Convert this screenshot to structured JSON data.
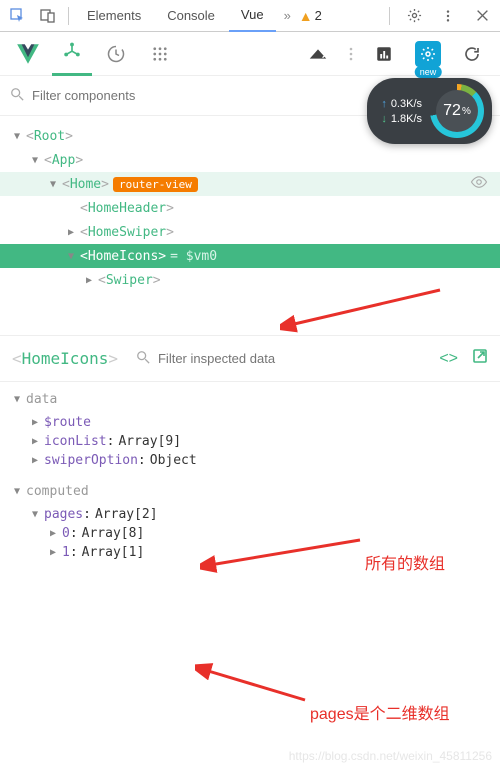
{
  "topTabs": {
    "elements": "Elements",
    "console": "Console",
    "vue": "Vue",
    "moreIndicator": "»",
    "warnCount": "2"
  },
  "toolbar": {
    "newBadge": "new"
  },
  "filter": {
    "placeholder": "Filter components"
  },
  "perf": {
    "up": "0.3K/s",
    "down": "1.8K/s",
    "percent": "72",
    "percentSuffix": "%"
  },
  "tree": [
    {
      "indent": 0,
      "toggle": "▼",
      "name": "Root"
    },
    {
      "indent": 1,
      "toggle": "▼",
      "name": "App"
    },
    {
      "indent": 2,
      "toggle": "▼",
      "name": "Home",
      "badge": "router-view",
      "eye": true
    },
    {
      "indent": 3,
      "toggle": "",
      "name": "HomeHeader"
    },
    {
      "indent": 3,
      "toggle": "▶",
      "name": "HomeSwiper"
    },
    {
      "indent": 3,
      "toggle": "▼",
      "name": "HomeIcons",
      "selected": true,
      "assign": " = $vm0"
    },
    {
      "indent": 4,
      "toggle": "▶",
      "name": "Swiper"
    }
  ],
  "inspector": {
    "componentName": "HomeIcons",
    "filterPlaceholder": "Filter inspected data"
  },
  "dataSection": {
    "label": "data",
    "items": [
      {
        "toggle": "▶",
        "key": "$route",
        "value": ""
      },
      {
        "toggle": "▶",
        "key": "iconList",
        "value": "Array[9]"
      },
      {
        "toggle": "▶",
        "key": "swiperOption",
        "value": "Object"
      }
    ]
  },
  "computedSection": {
    "label": "computed",
    "items": [
      {
        "toggle": "▼",
        "key": "pages",
        "value": "Array[2]"
      }
    ],
    "subItems": [
      {
        "toggle": "▶",
        "key": "0",
        "value": "Array[8]"
      },
      {
        "toggle": "▶",
        "key": "1",
        "value": "Array[1]"
      }
    ]
  },
  "annotations": {
    "ann1": "所有的数组",
    "ann2": "pages是个二维数组"
  },
  "watermark": "https://blog.csdn.net/weixin_45811256"
}
